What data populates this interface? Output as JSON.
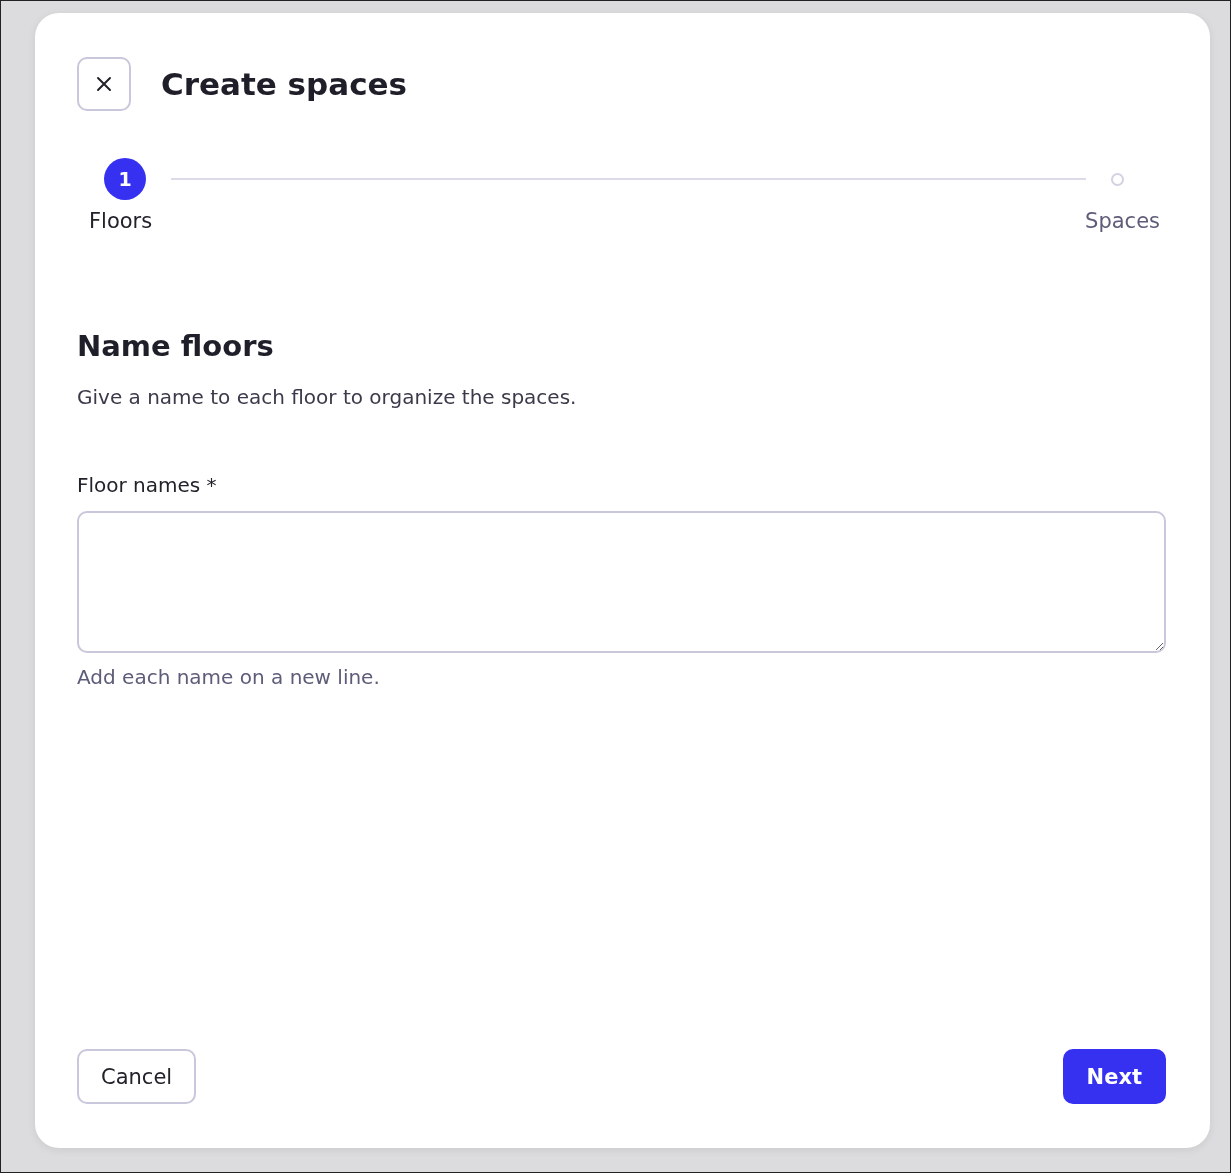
{
  "dialog": {
    "title": "Create spaces",
    "steps": [
      {
        "label": "Floors",
        "number": "1",
        "selected": true
      },
      {
        "label": "Spaces",
        "selected": false
      }
    ],
    "section": {
      "heading": "Name floors",
      "description": "Give a name to each floor to organize the spaces."
    },
    "field": {
      "label": "Floor names *",
      "helper": "Add each name on a new line."
    },
    "buttons": [
      {
        "label": "Cancel",
        "kind": "secondary"
      },
      {
        "label": "Next",
        "kind": "primary"
      }
    ]
  }
}
